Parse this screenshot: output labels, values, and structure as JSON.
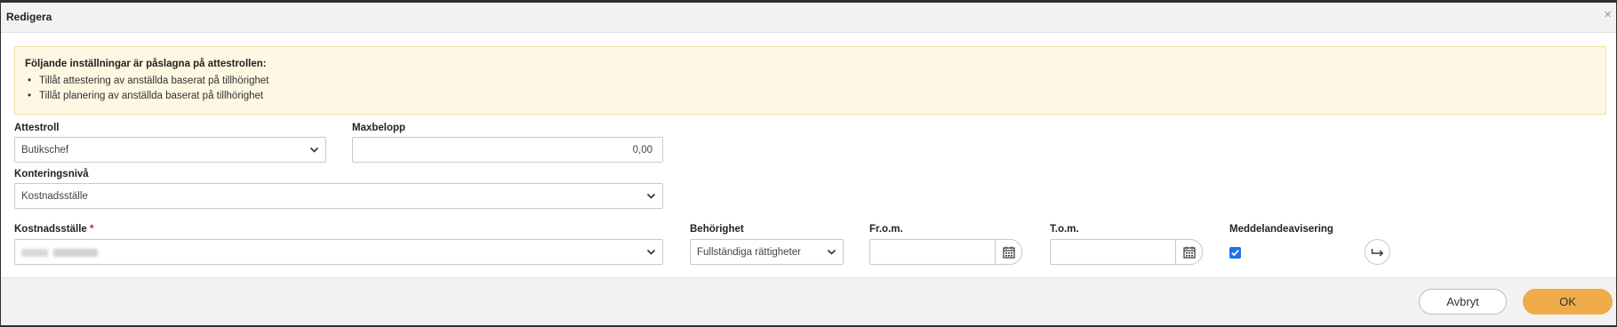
{
  "dialog": {
    "title": "Redigera",
    "close_glyph": "×"
  },
  "info": {
    "heading": "Följande inställningar är påslagna på attestrollen:",
    "items": [
      "Tillåt attestering av anställda baserat på tillhörighet",
      "Tillåt planering av anställda baserat på tillhörighet"
    ]
  },
  "form": {
    "attestroll": {
      "label": "Attestroll",
      "value": "Butikschef"
    },
    "maxbelopp": {
      "label": "Maxbelopp",
      "value": "0,00"
    },
    "konteringsniva": {
      "label": "Konteringsnivå",
      "value": "Kostnadsställe"
    },
    "kostnadsstalle": {
      "label": "Kostnadsställe",
      "required_mark": "*"
    },
    "behorighet": {
      "label": "Behörighet",
      "value": "Fullständiga rättigheter"
    },
    "from": {
      "label": "Fr.o.m.",
      "value": ""
    },
    "tom": {
      "label": "T.o.m.",
      "value": ""
    },
    "meddelande": {
      "label": "Meddelandeavisering",
      "checked": true
    }
  },
  "footer": {
    "cancel_label": "Avbryt",
    "ok_label": "OK"
  },
  "colors": {
    "accent": "#f0ab4a",
    "checkbox": "#1a73e8",
    "info_bg": "#fdf7e3",
    "required": "#c62828"
  },
  "icons": [
    "close-icon",
    "chevron-down-icon",
    "calendar-icon",
    "check-icon",
    "arrow-return-icon"
  ]
}
